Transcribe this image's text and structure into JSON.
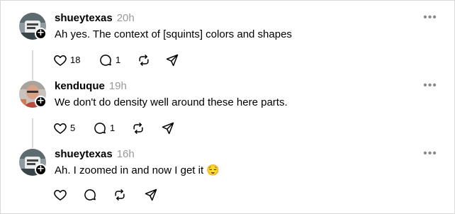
{
  "posts": [
    {
      "username": "shueytexas",
      "time": "20h",
      "text": "Ah yes. The context of [squints] colors and shapes",
      "likes": "18",
      "replies": "1",
      "avatar": "avatar-shueytexas",
      "icons": [
        "heart-icon",
        "reply-icon",
        "repost-icon",
        "share-icon",
        "more-icon",
        "follow-plus-icon"
      ]
    },
    {
      "username": "kenduque",
      "time": "19h",
      "text": "We don't do density well around these here parts.",
      "likes": "5",
      "replies": "1",
      "avatar": "avatar-kenduque",
      "icons": [
        "heart-icon",
        "reply-icon",
        "repost-icon",
        "share-icon",
        "more-icon",
        "follow-plus-icon"
      ]
    },
    {
      "username": "shueytexas",
      "time": "16h",
      "text": "Ah. I zoomed in and now I get it 😌",
      "likes": "",
      "replies": "",
      "avatar": "avatar-shueytexas",
      "icons": [
        "heart-icon",
        "reply-icon",
        "repost-icon",
        "share-icon",
        "more-icon",
        "follow-plus-icon"
      ]
    }
  ],
  "colors": {
    "border": "#d9d9d9",
    "muted": "#999999",
    "text": "#000000",
    "badge": "#000000"
  }
}
